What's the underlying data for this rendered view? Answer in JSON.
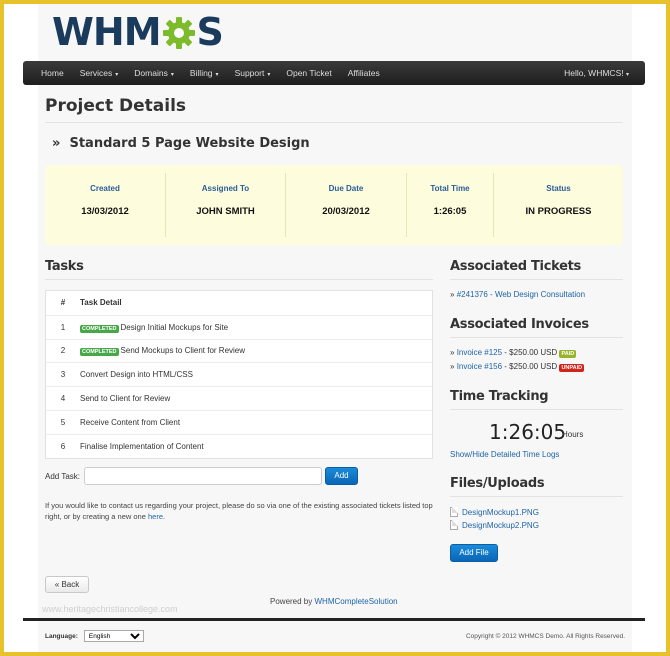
{
  "brand": {
    "logo_left": "WHM",
    "logo_right": "S",
    "gear_icon": "gear-icon"
  },
  "nav": {
    "items": [
      {
        "label": "Home",
        "dropdown": false
      },
      {
        "label": "Services",
        "dropdown": true
      },
      {
        "label": "Domains",
        "dropdown": true
      },
      {
        "label": "Billing",
        "dropdown": true
      },
      {
        "label": "Support",
        "dropdown": true
      },
      {
        "label": "Open Ticket",
        "dropdown": false
      },
      {
        "label": "Affiliates",
        "dropdown": false
      }
    ],
    "caret": "▾",
    "user": "Hello, WHMCS!",
    "user_caret": "▾"
  },
  "page_title": "Project Details",
  "project": {
    "prefix": "»",
    "name": "Standard 5 Page Website Design"
  },
  "summary": [
    {
      "label": "Created",
      "value": "13/03/2012"
    },
    {
      "label": "Assigned To",
      "value": "JOHN SMITH"
    },
    {
      "label": "Due Date",
      "value": "20/03/2012"
    },
    {
      "label": "Total Time",
      "value": "1:26:05"
    },
    {
      "label": "Status",
      "value": "IN PROGRESS"
    }
  ],
  "tasks": {
    "title": "Tasks",
    "col_num": "#",
    "col_detail": "Task Detail",
    "completed_badge": "COMPLETED",
    "rows": [
      {
        "num": "1",
        "completed": true,
        "text": "Design Initial Mockups for Site"
      },
      {
        "num": "2",
        "completed": true,
        "text": "Send Mockups to Client for Review"
      },
      {
        "num": "3",
        "completed": false,
        "text": "Convert Design into HTML/CSS"
      },
      {
        "num": "4",
        "completed": false,
        "text": "Send to Client for Review"
      },
      {
        "num": "5",
        "completed": false,
        "text": "Receive Content from Client"
      },
      {
        "num": "6",
        "completed": false,
        "text": "Finalise Implementation of Content"
      }
    ],
    "add_label": "Add Task:",
    "add_value": "",
    "add_button": "Add"
  },
  "contact": {
    "text": "If you would like to contact us regarding your project, please do so via one of the existing associated tickets listed top right, or by creating a new one",
    "link": "here",
    "end": "."
  },
  "tickets": {
    "title": "Associated Tickets",
    "items": [
      "#241376 - Web Design Consultation"
    ]
  },
  "invoices": {
    "title": "Associated Invoices",
    "items": [
      {
        "link": "Invoice #125",
        "amount": " - $250.00 USD ",
        "status": "PAID"
      },
      {
        "link": "Invoice #156",
        "amount": " - $250.00 USD ",
        "status": "UNPAID"
      }
    ]
  },
  "time": {
    "title": "Time Tracking",
    "value": "1:26:05",
    "unit": "Hours",
    "toggle": "Show/Hide Detailed Time Logs"
  },
  "files": {
    "title": "Files/Uploads",
    "items": [
      "DesignMockup1.PNG",
      "DesignMockup2.PNG"
    ],
    "add_button": "Add File"
  },
  "back_button": "« Back",
  "powered": {
    "text": "Powered by",
    "link": "WHMCompleteSolution"
  },
  "watermark": "www.heritagechristiancollege.com",
  "footer": {
    "language_label": "Language:",
    "language_value": "English",
    "copyright": "Copyright © 2012 WHMCS Demo. All Rights Reserved."
  },
  "colors": {
    "accent": "#0a66b6",
    "brand_dark": "#1a3b5c",
    "brand_green": "#7dbb2b",
    "frame": "#e8c22a",
    "summary_bg": "#fdfcdd"
  }
}
